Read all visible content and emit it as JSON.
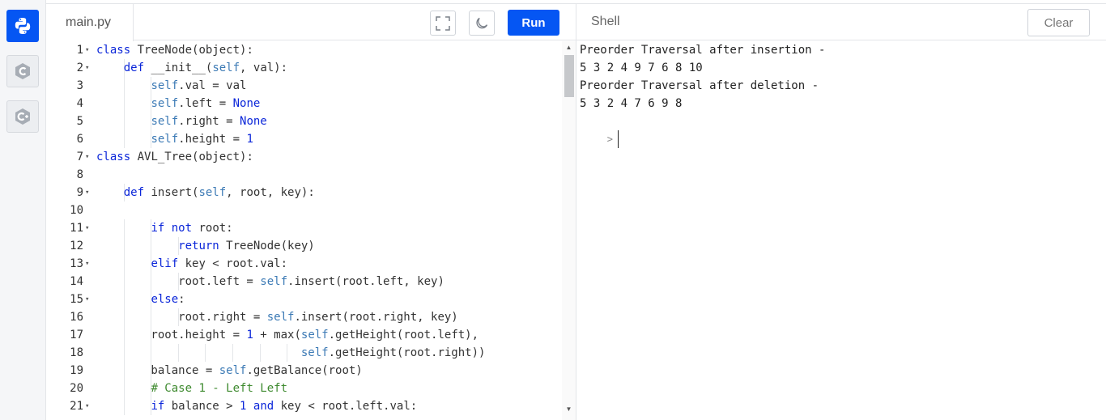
{
  "sidebar": {
    "languages": [
      {
        "icon": "python-icon",
        "active": true
      },
      {
        "icon": "c-language-icon",
        "active": false
      },
      {
        "icon": "cpp-language-icon",
        "active": false
      }
    ]
  },
  "editor": {
    "tab_label": "main.py",
    "run_label": "Run",
    "lines": [
      {
        "n": "1",
        "fold": true
      },
      {
        "n": "2",
        "fold": true
      },
      {
        "n": "3",
        "fold": false
      },
      {
        "n": "4",
        "fold": false
      },
      {
        "n": "5",
        "fold": false
      },
      {
        "n": "6",
        "fold": false
      },
      {
        "n": "7",
        "fold": true
      },
      {
        "n": "8",
        "fold": false
      },
      {
        "n": "9",
        "fold": true
      },
      {
        "n": "10",
        "fold": false
      },
      {
        "n": "11",
        "fold": true
      },
      {
        "n": "12",
        "fold": false
      },
      {
        "n": "13",
        "fold": true
      },
      {
        "n": "14",
        "fold": false
      },
      {
        "n": "15",
        "fold": true
      },
      {
        "n": "16",
        "fold": false
      },
      {
        "n": "17",
        "fold": false
      },
      {
        "n": "18",
        "fold": false
      },
      {
        "n": "19",
        "fold": false
      },
      {
        "n": "20",
        "fold": false
      },
      {
        "n": "21",
        "fold": true
      }
    ],
    "code": [
      "class TreeNode(object):",
      "    def __init__(self, val):",
      "        self.val = val",
      "        self.left = None",
      "        self.right = None",
      "        self.height = 1",
      "class AVL_Tree(object):",
      "",
      "    def insert(self, root, key):",
      "",
      "        if not root:",
      "            return TreeNode(key)",
      "        elif key < root.val:",
      "            root.left = self.insert(root.left, key)",
      "        else:",
      "            root.right = self.insert(root.right, key)",
      "        root.height = 1 + max(self.getHeight(root.left),",
      "                              self.getHeight(root.right))",
      "        balance = self.getBalance(root)",
      "        # Case 1 - Left Left",
      "        if balance > 1 and key < root.left.val:"
    ]
  },
  "shell": {
    "title": "Shell",
    "clear_label": "Clear",
    "output": [
      "Preorder Traversal after insertion -",
      "5 3 2 4 9 7 6 8 10",
      "Preorder Traversal after deletion -",
      "5 3 2 4 7 6 9 8"
    ],
    "prompt": ">"
  }
}
